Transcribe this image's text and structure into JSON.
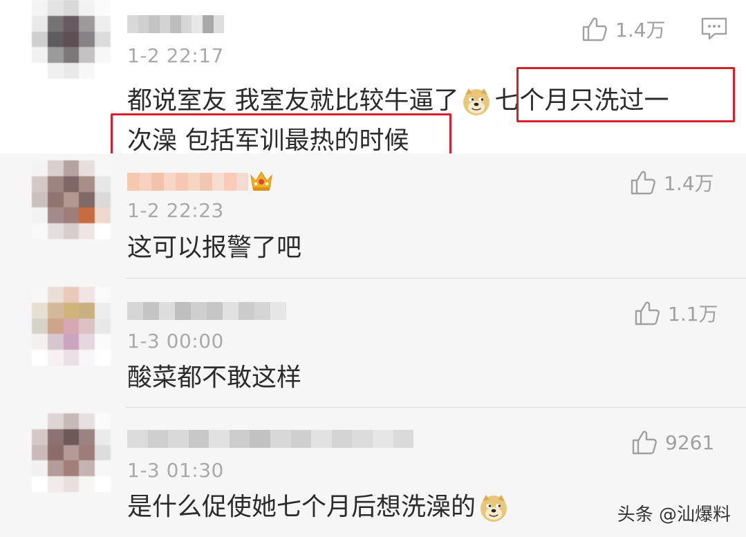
{
  "comments": [
    {
      "time": "1-2 22:17",
      "likes": "1.4万",
      "text_line1_a": "都说室友 我室友就比较牛逼了",
      "text_line1_b": "七个月只洗过一",
      "text_line2": "次澡 包括军训最热的时候",
      "has_reply_icon": true,
      "avatar_colors": [
        "#f4f4f4",
        "#e3e3e3",
        "#d9d9d9",
        "#f2f2f2",
        "#fbfbfb",
        "#e9e9e9",
        "#747474",
        "#675a60",
        "#9e9a9c",
        "#eeeeee",
        "#cfcfcf",
        "#5d5c5e",
        "#5e4f54",
        "#868286",
        "#dcdcdc",
        "#f1f1f1",
        "#9b9b9b",
        "#7c787a",
        "#c4c2c3",
        "#f7f7f7",
        "#ffffff",
        "#f0f0f0",
        "#e9e9e9",
        "#f7f7f7",
        "#ffffff"
      ],
      "nickname_colors": [
        "#d9d9d9",
        "#cfcfcf",
        "#c4c4c4",
        "#d3d3d3",
        "#bdbdbd",
        "#d6d6d6",
        "#e7e7e7",
        "#a9a9a9",
        "#dedede"
      ]
    },
    {
      "time": "1-2 22:23",
      "likes": "1.4万",
      "text": "这可以报警了吧",
      "has_crown": true,
      "avatar_colors": [
        "#f3f3f3",
        "#d9cfcf",
        "#b7a2a2",
        "#e8dede",
        "#f7f7f7",
        "#d5c9c7",
        "#9c8581",
        "#7e6764",
        "#a88e89",
        "#e7e7e7",
        "#ccc0bf",
        "#8f7470",
        "#b39891",
        "#7f6a68",
        "#dadada",
        "#f2f2f2",
        "#a48a8a",
        "#9e7d7a",
        "#c76c3f",
        "#efd9cf",
        "#f9f9f9",
        "#e5dede",
        "#d8cccc",
        "#efe5e5",
        "#ffffff"
      ],
      "nickname_colors": [
        "#f6c8ae",
        "#f8d2bf",
        "#f2c3ab",
        "#f7d6c7",
        "#f8c7b3",
        "#f6d5c2",
        "#f2c7b1",
        "#f7dccf",
        "#f8ccb8",
        "#f3dbd0"
      ]
    },
    {
      "time": "1-3 00:00",
      "likes": "1.1万",
      "text": "酸菜都不敢这样",
      "avatar_colors": [
        "#f7f7f7",
        "#e9dfd7",
        "#e9c9b9",
        "#f2e4e3",
        "#fafafa",
        "#e6e0d3",
        "#d3b99a",
        "#cfb57a",
        "#c9b07f",
        "#ececec",
        "#d6d4c9",
        "#cfa48c",
        "#d7a8b3",
        "#dcc2c5",
        "#e8e8e8",
        "#f4f0ef",
        "#d7c6d0",
        "#cda4bf",
        "#e6d7df",
        "#fbfbfb",
        "#ffffff",
        "#f6f0f3",
        "#e9e0e6",
        "#f8f6f8",
        "#ffffff"
      ],
      "nickname_colors": [
        "#d6d6d6",
        "#c4c4c4",
        "#dddddd",
        "#bfbfbf",
        "#cfcfcf",
        "#c6c6c6",
        "#e1e1e1",
        "#cbcbcb",
        "#d5d5d5",
        "#e6e6e6"
      ]
    },
    {
      "time": "1-3 01:30",
      "likes": "9261",
      "text": "是什么促使她七个月后想洗澡的",
      "has_doge_end": true,
      "avatar_colors": [
        "#f6f6f6",
        "#ddd5d5",
        "#c7b9b8",
        "#e7e0e0",
        "#fafafa",
        "#d5c8c7",
        "#8c7270",
        "#6f5957",
        "#9a8381",
        "#ebebeb",
        "#cbbab8",
        "#8c6c6a",
        "#b49b98",
        "#9c7d7a",
        "#dddddd",
        "#f2f0f0",
        "#b49c9a",
        "#a37f7c",
        "#c5b3b1",
        "#f7f7f7",
        "#ffffff",
        "#f1eaea",
        "#e8e0df",
        "#f8f5f5",
        "#ffffff"
      ],
      "nickname_colors": [
        "#dcdcdc",
        "#cfcfcf",
        "#d9d9d9",
        "#c8c8c8",
        "#e1e1e1",
        "#cdcdcd",
        "#c2c2c2",
        "#d8d8d8",
        "#cfcfcf",
        "#e2e2e2",
        "#d4d4d4",
        "#dcdcdc",
        "#e6e6e6",
        "#dadada"
      ]
    }
  ],
  "watermark": "头条 @汕爆料",
  "colors": {
    "highlight": "#d81e2a",
    "meta_gray": "#a9a9a9",
    "text": "#2b2b2b"
  }
}
